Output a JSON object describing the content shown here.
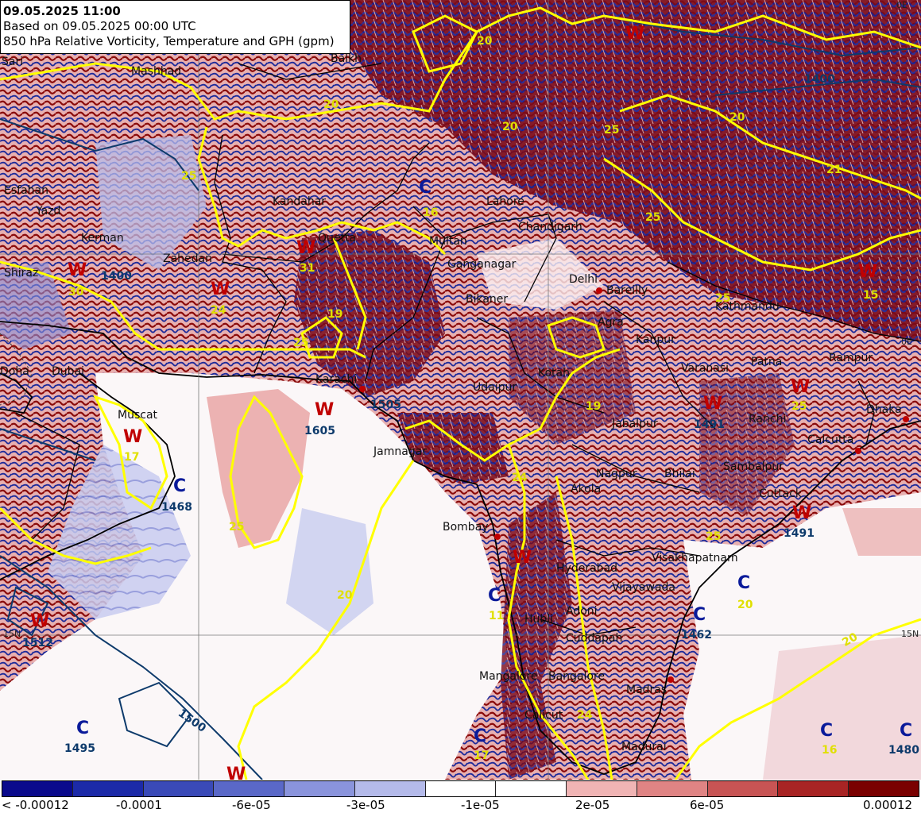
{
  "header": {
    "line1": "09.05.2025 11:00",
    "line2": "Based on 09.05.2025 00:00 UTC",
    "line3": "850 hPa Relative Vorticity, Temperature and GPH (gpm)"
  },
  "legend": {
    "colors": [
      "#0a0a8c",
      "#1c2aa8",
      "#3a4ab8",
      "#5a68c8",
      "#8a94dc",
      "#b4baea",
      "#ffffff",
      "#ffffff",
      "#f0b4b4",
      "#e08484",
      "#c85454",
      "#a82424",
      "#7a0000"
    ],
    "labels": [
      "< -0.00012",
      "-0.0001",
      "-6e-05",
      "-3e-05",
      "-1e-05",
      "2e-05",
      "6e-05",
      "0.00012"
    ]
  },
  "lat_labels": {
    "left": "15N",
    "right": "15N",
    "corner": "0E"
  },
  "cities": [
    {
      "name": "Sari"
    },
    {
      "name": "Mashhad"
    },
    {
      "name": "Balkh"
    },
    {
      "name": "Esfahan"
    },
    {
      "name": "Yazd"
    },
    {
      "name": "Kerman"
    },
    {
      "name": "Zahedan"
    },
    {
      "name": "Shiraz"
    },
    {
      "name": "Kandahar"
    },
    {
      "name": "Quetta"
    },
    {
      "name": "Multan"
    },
    {
      "name": "Lahore"
    },
    {
      "name": "Chandigarh"
    },
    {
      "name": "Ganganagar"
    },
    {
      "name": "Delhi"
    },
    {
      "name": "Bareilly"
    },
    {
      "name": "Bikaner"
    },
    {
      "name": "Agra"
    },
    {
      "name": "Kanpur"
    },
    {
      "name": "Varanasi"
    },
    {
      "name": "Patna"
    },
    {
      "name": "Rampur"
    },
    {
      "name": "Kathmandu"
    },
    {
      "name": "Doha"
    },
    {
      "name": "Dubai"
    },
    {
      "name": "Muscat"
    },
    {
      "name": "Karachi"
    },
    {
      "name": "Kotah"
    },
    {
      "name": "Udaipur"
    },
    {
      "name": "Jamnagar"
    },
    {
      "name": "Jabalpur"
    },
    {
      "name": "Ranchi"
    },
    {
      "name": "Calcutta"
    },
    {
      "name": "Dhaka"
    },
    {
      "name": "Nagpur"
    },
    {
      "name": "Bhilai"
    },
    {
      "name": "Sambalpur"
    },
    {
      "name": "Cuttack"
    },
    {
      "name": "Bombay"
    },
    {
      "name": "Akola"
    },
    {
      "name": "Hyderabad"
    },
    {
      "name": "Visakhapatnam"
    },
    {
      "name": "Vijayawada"
    },
    {
      "name": "Adoni"
    },
    {
      "name": "Hubli"
    },
    {
      "name": "Cuddapah"
    },
    {
      "name": "Mangalore"
    },
    {
      "name": "Bangalore"
    },
    {
      "name": "Madras"
    },
    {
      "name": "Calicut"
    },
    {
      "name": "Madurai"
    }
  ],
  "pressure_marks": [
    {
      "type": "W"
    },
    {
      "type": "W"
    },
    {
      "type": "W"
    },
    {
      "type": "W"
    },
    {
      "type": "W"
    },
    {
      "type": "W"
    },
    {
      "type": "W"
    },
    {
      "type": "W"
    },
    {
      "type": "W"
    },
    {
      "type": "W"
    },
    {
      "type": "W"
    },
    {
      "type": "W"
    },
    {
      "type": "W"
    },
    {
      "type": "C"
    },
    {
      "type": "C"
    },
    {
      "type": "C"
    },
    {
      "type": "C"
    },
    {
      "type": "C"
    },
    {
      "type": "C"
    },
    {
      "type": "C"
    },
    {
      "type": "C"
    },
    {
      "type": "C"
    }
  ],
  "gph_labels": [
    "1400",
    "1400",
    "1491",
    "1605",
    "1505",
    "1468",
    "1512",
    "1495",
    "1462",
    "1480",
    "1491",
    "1500",
    "1491",
    "1512"
  ],
  "temp_labels": [
    "20",
    "20",
    "20",
    "20",
    "25",
    "25",
    "25",
    "25",
    "30",
    "31",
    "19",
    "19",
    "16",
    "25",
    "25",
    "24",
    "17",
    "17",
    "15",
    "20",
    "11",
    "24",
    "25",
    "20",
    "25",
    "20",
    "21",
    "24",
    "16"
  ]
}
